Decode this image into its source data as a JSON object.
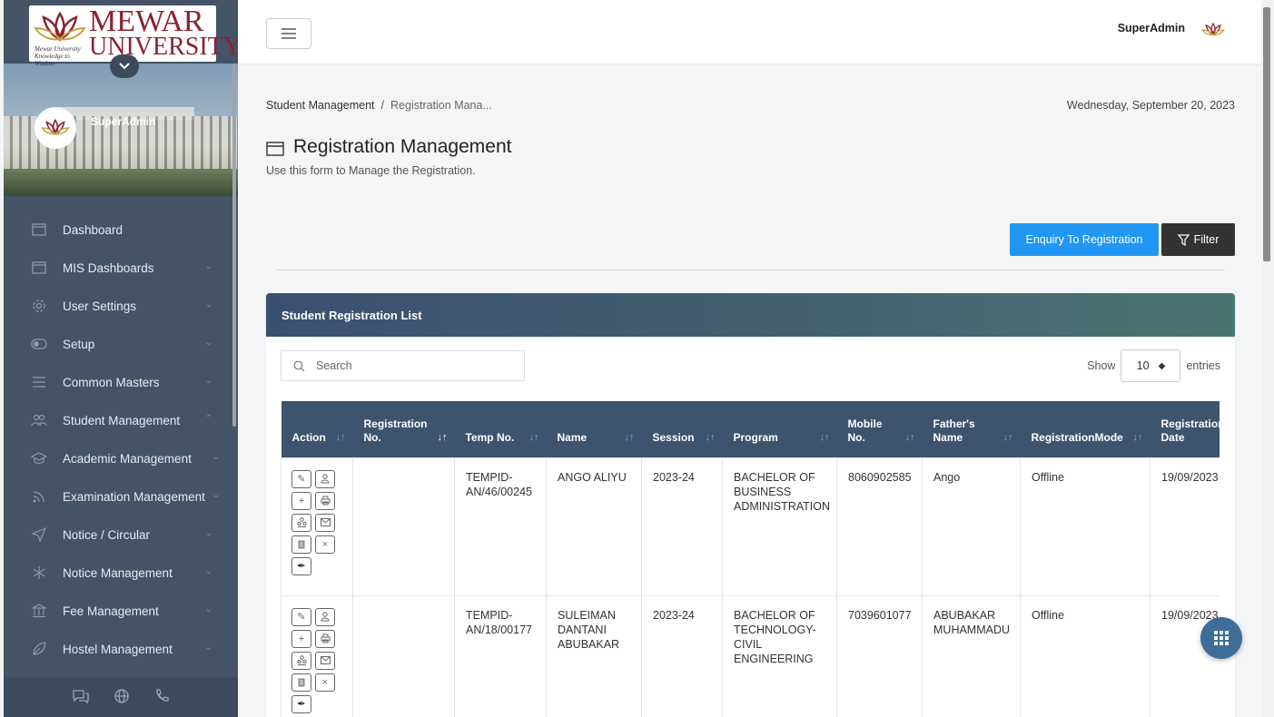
{
  "app": {
    "logo": {
      "line1": "MEWAR",
      "line2": "UNIVERSITY",
      "tagline": "Mewar University Knowledge to Wisdom",
      "brand_color": "#8a2230"
    },
    "sidebar_user": "SuperAdmin",
    "header_user": "SuperAdmin"
  },
  "sidebar": {
    "items": [
      {
        "label": "Dashboard",
        "icon": "window-icon",
        "has_chevron": false
      },
      {
        "label": "MIS Dashboards",
        "icon": "window-icon",
        "has_chevron": true
      },
      {
        "label": "User Settings",
        "icon": "gear-icon",
        "has_chevron": true
      },
      {
        "label": "Setup",
        "icon": "toggle-icon",
        "has_chevron": true
      },
      {
        "label": "Common Masters",
        "icon": "menu-lines-icon",
        "has_chevron": true
      },
      {
        "label": "Student Management",
        "icon": "users-icon",
        "has_chevron": true,
        "expanded": true
      },
      {
        "label": "Academic Management",
        "icon": "graduation-cap-icon",
        "has_chevron": true
      },
      {
        "label": "Examination Management",
        "icon": "rss-icon",
        "has_chevron": true
      },
      {
        "label": "Notice / Circular",
        "icon": "paper-plane-icon",
        "has_chevron": true
      },
      {
        "label": "Notice Management",
        "icon": "snowflake-icon",
        "has_chevron": true
      },
      {
        "label": "Fee Management",
        "icon": "bank-icon",
        "has_chevron": true
      },
      {
        "label": "Hostel Management",
        "icon": "leaf-icon",
        "has_chevron": true
      }
    ],
    "footer_icons": [
      "chat-icon",
      "globe-icon",
      "phone-icon"
    ]
  },
  "breadcrumb": {
    "root": "Student Management",
    "separator": "/",
    "current": "Registration Mana..."
  },
  "date": "Wednesday, September 20, 2023",
  "page": {
    "title": "Registration Management",
    "subtitle": "Use this form to Manage the Registration."
  },
  "buttons": {
    "enquiry": "Enquiry To Registration",
    "filter": "Filter",
    "enquiry_color": "#2196f3"
  },
  "card": {
    "title": "Student Registration List"
  },
  "search": {
    "placeholder": "Search"
  },
  "entries": {
    "show": "Show",
    "value": "10",
    "suffix": "entries"
  },
  "table": {
    "headers": {
      "action": "Action",
      "registration_no": "Registration No.",
      "temp_no": "Temp No.",
      "name": "Name",
      "session": "Session",
      "program": "Program",
      "mobile": "Mobile No.",
      "father": "Father's Name",
      "mode": "RegistrationMode",
      "reg_date": "Registration Date"
    },
    "rows": [
      {
        "registration_no": "",
        "temp_no": "TEMPID-AN/46/00245",
        "name": "ANGO ALIYU",
        "session": "2023-24",
        "program": "BACHELOR OF BUSINESS ADMINISTRATION",
        "mobile": "8060902585",
        "father": "Ango",
        "mode": "Offline",
        "reg_date": "19/09/2023"
      },
      {
        "registration_no": "",
        "temp_no": "TEMPID-AN/18/00177",
        "name": "SULEIMAN DANTANI ABUBAKAR",
        "session": "2023-24",
        "program": "BACHELOR OF TECHNOLOGY-CIVIL ENGINEERING",
        "mobile": "7039601077",
        "father": "ABUBAKAR MUHAMMADU",
        "mode": "Offline",
        "reg_date": "19/09/2023"
      }
    ]
  }
}
